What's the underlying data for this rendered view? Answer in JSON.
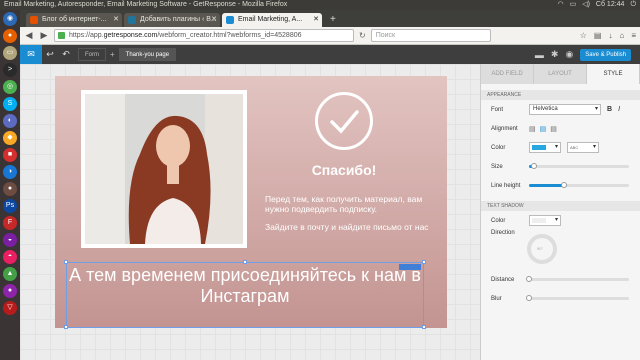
{
  "window": {
    "title": "Email Marketing, Autoresponder, Email Marketing Software - GetResponse - Mozilla Firefox",
    "clock": "Сб 12:44"
  },
  "tabs": [
    {
      "label": "Блог об интернет-...",
      "color": "#e65100"
    },
    {
      "label": "Добавить плагины ‹ В...",
      "color": "#21759b"
    },
    {
      "label": "Email Marketing, A...",
      "color": "#1a8cd1"
    }
  ],
  "new_tab": "+",
  "url": {
    "prefix": "https://app.",
    "domain": "getresponse.com",
    "path": "/webform_creator.html?webforms_id=4528806"
  },
  "search_placeholder": "Поиск",
  "app": {
    "page_tabs": [
      "Form",
      "+",
      "Thank-you page"
    ],
    "publish_label": "Save & Publish"
  },
  "form": {
    "thanks": "Спасибо!",
    "paragraph1": "Перед тем, как получить материал, вам нужно подвердить подписку.",
    "paragraph2": "Зайдите в почту и найдите письмо от нас",
    "big_text": "А тем временем присоединяйтесь к нам в Инстаграм"
  },
  "panel": {
    "tabs": [
      "ADD FIELD",
      "LAYOUT",
      "STYLE"
    ],
    "appearance_header": "APPEARANCE",
    "font_label": "Font",
    "font_value": "Helvetica",
    "bold": "B",
    "italic": "I",
    "alignment_label": "Alignment",
    "color_label": "Color",
    "color_value": "#29a8e0",
    "bg_value": "ABC",
    "size_label": "Size",
    "size_level": 0.05,
    "line_height_label": "Line height",
    "line_height_level": 0.35,
    "text_shadow_header": "TEXT SHADOW",
    "shadow_color_label": "Color",
    "direction_label": "Direction",
    "direction_value": "90°",
    "distance_label": "Distance",
    "distance_level": 0,
    "blur_label": "Blur",
    "blur_level": 0
  },
  "launcher_icons": [
    "ubuntu-icon",
    "firefox-icon",
    "files-icon",
    "terminal-icon",
    "chrome-icon",
    "skype-icon",
    "app-icon",
    "app-icon",
    "app-icon",
    "app-icon",
    "app-icon",
    "app-icon",
    "app-icon",
    "app-icon",
    "app-icon",
    "app-icon",
    "app-icon",
    "trash-icon"
  ]
}
